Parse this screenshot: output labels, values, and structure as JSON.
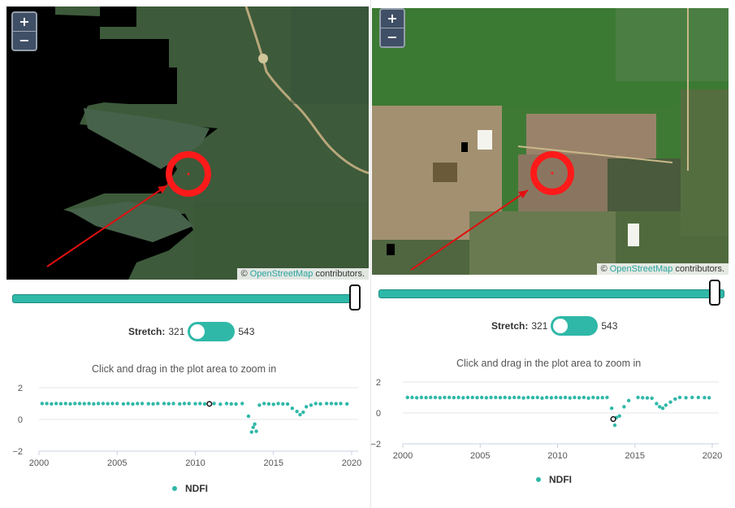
{
  "colors": {
    "accent": "#2fb8a8",
    "marker": "#ff1a1a",
    "arrow": "#e01010"
  },
  "panels": [
    {
      "zoom_in": "+",
      "zoom_out": "−",
      "attribution": {
        "prefix": "©",
        "link": "OpenStreetMap",
        "suffix": "contributors."
      },
      "stretch": {
        "label": "Stretch:",
        "min": "321",
        "max": "543"
      },
      "hint": "Click and drag in the plot area to zoom in",
      "legend": "NDFI",
      "slider_value": 1.0
    },
    {
      "zoom_in": "+",
      "zoom_out": "−",
      "attribution": {
        "prefix": "©",
        "link": "OpenStreetMap",
        "suffix": "contributors."
      },
      "stretch": {
        "label": "Stretch:",
        "min": "321",
        "max": "543"
      },
      "hint": "Click and drag in the plot area to zoom in",
      "legend": "NDFI",
      "slider_value": 1.0
    }
  ],
  "chart_data": [
    {
      "type": "scatter",
      "series": [
        {
          "name": "NDFI",
          "x": [
            2000.2,
            2000.5,
            2000.8,
            2001.1,
            2001.4,
            2001.7,
            2002.0,
            2002.3,
            2002.6,
            2002.9,
            2003.2,
            2003.5,
            2003.8,
            2004.1,
            2004.4,
            2004.7,
            2005.0,
            2005.4,
            2005.7,
            2006.0,
            2006.3,
            2006.6,
            2007.0,
            2007.3,
            2007.6,
            2008.0,
            2008.3,
            2008.6,
            2009.0,
            2009.3,
            2009.6,
            2010.0,
            2010.3,
            2010.6,
            2011.2,
            2011.6,
            2012.0,
            2012.3,
            2012.6,
            2013.0,
            2013.4,
            2013.6,
            2013.7,
            2013.8,
            2013.9,
            2014.1,
            2014.4,
            2014.7,
            2015.0,
            2015.3,
            2015.6,
            2015.9,
            2016.2,
            2016.5,
            2016.7,
            2016.9,
            2017.1,
            2017.4,
            2017.7,
            2018.0,
            2018.4,
            2018.7,
            2019.0,
            2019.3,
            2019.7
          ],
          "y": [
            1.0,
            1.0,
            0.98,
            1.0,
            0.99,
            1.0,
            0.98,
            1.0,
            1.0,
            0.99,
            1.0,
            0.98,
            1.0,
            1.0,
            0.99,
            1.0,
            1.0,
            0.98,
            1.0,
            0.97,
            1.0,
            1.0,
            0.99,
            0.98,
            1.0,
            1.0,
            0.99,
            1.0,
            0.98,
            1.0,
            1.0,
            0.99,
            1.0,
            0.98,
            1.0,
            0.96,
            1.0,
            0.98,
            0.97,
            1.0,
            0.2,
            -0.8,
            -0.5,
            -0.3,
            -0.75,
            0.9,
            1.0,
            0.98,
            0.95,
            1.0,
            0.98,
            0.97,
            0.7,
            0.5,
            0.3,
            0.45,
            0.8,
            0.9,
            1.0,
            0.98,
            1.0,
            1.0,
            0.99,
            1.0,
            0.98
          ]
        }
      ],
      "highlight": {
        "x": 2010.9,
        "y": 0.98
      },
      "x_ticks": [
        "2000",
        "2005",
        "2010",
        "2015",
        "2020"
      ],
      "y_ticks": [
        "2",
        "0",
        "−2"
      ],
      "xlim": [
        2000,
        2020
      ],
      "ylim": [
        -2,
        2
      ]
    },
    {
      "type": "scatter",
      "series": [
        {
          "name": "NDFI",
          "x": [
            2000.3,
            2000.6,
            2000.9,
            2001.2,
            2001.5,
            2001.8,
            2002.1,
            2002.4,
            2002.7,
            2003.0,
            2003.3,
            2003.6,
            2003.9,
            2004.2,
            2004.5,
            2004.8,
            2005.1,
            2005.4,
            2005.7,
            2006.0,
            2006.3,
            2006.6,
            2006.9,
            2007.2,
            2007.5,
            2007.8,
            2008.1,
            2008.4,
            2008.7,
            2009.0,
            2009.3,
            2009.6,
            2009.9,
            2010.2,
            2010.5,
            2010.8,
            2011.1,
            2011.4,
            2011.7,
            2012.0,
            2012.3,
            2012.6,
            2012.9,
            2013.2,
            2013.5,
            2013.6,
            2013.7,
            2013.8,
            2014.0,
            2014.3,
            2014.6,
            2015.2,
            2015.5,
            2015.8,
            2016.1,
            2016.4,
            2016.6,
            2016.8,
            2017.0,
            2017.3,
            2017.6,
            2017.9,
            2018.3,
            2018.7,
            2019.1,
            2019.5,
            2019.8
          ],
          "y": [
            1.0,
            1.0,
            0.98,
            1.0,
            0.99,
            1.0,
            1.0,
            0.98,
            1.0,
            1.0,
            0.99,
            1.0,
            0.98,
            1.0,
            1.0,
            0.99,
            1.0,
            0.98,
            1.0,
            1.0,
            0.99,
            1.0,
            0.98,
            1.0,
            1.0,
            0.97,
            1.0,
            0.99,
            1.0,
            0.96,
            1.0,
            0.98,
            1.0,
            0.99,
            1.0,
            0.97,
            1.0,
            0.98,
            1.0,
            0.96,
            1.0,
            0.98,
            0.99,
            1.0,
            0.3,
            -0.4,
            -0.8,
            -0.3,
            -0.2,
            0.4,
            0.8,
            1.0,
            0.98,
            0.97,
            0.95,
            0.6,
            0.4,
            0.3,
            0.5,
            0.7,
            0.9,
            1.0,
            0.98,
            1.0,
            1.0,
            0.99,
            0.98
          ]
        }
      ],
      "highlight": {
        "x": 2013.6,
        "y": -0.4
      },
      "x_ticks": [
        "2000",
        "2005",
        "2010",
        "2015",
        "2020"
      ],
      "y_ticks": [
        "2",
        "0",
        "−2"
      ],
      "xlim": [
        2000,
        2020
      ],
      "ylim": [
        -2,
        2
      ]
    }
  ]
}
